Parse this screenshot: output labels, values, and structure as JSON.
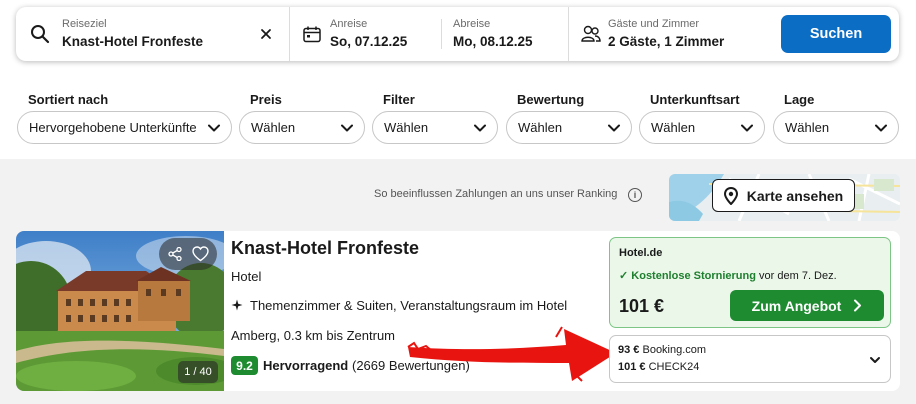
{
  "search": {
    "destination_caption": "Reiseziel",
    "destination_value": "Knast-Hotel Fronfeste",
    "checkin_caption": "Anreise",
    "checkin_value": "So, 07.12.25",
    "checkout_caption": "Abreise",
    "checkout_value": "Mo, 08.12.25",
    "guests_caption": "Gäste und Zimmer",
    "guests_value": "2 Gäste, 1 Zimmer",
    "search_button": "Suchen",
    "accent_color": "#0b6dc4"
  },
  "filters": [
    {
      "label": "Sortiert nach",
      "value": "Hervorgehobene Unterkünfte"
    },
    {
      "label": "Preis",
      "value": "Wählen"
    },
    {
      "label": "Filter",
      "value": "Wählen"
    },
    {
      "label": "Bewertung",
      "value": "Wählen"
    },
    {
      "label": "Unterkunftsart",
      "value": "Wählen"
    },
    {
      "label": "Lage",
      "value": "Wählen"
    }
  ],
  "results": {
    "ranking_note": "So beeinflussen Zahlungen an uns unser Ranking",
    "info_symbol": "i",
    "map_button": "Karte ansehen"
  },
  "hotel": {
    "name": "Knast-Hotel Fronfeste",
    "type": "Hotel",
    "features": "Themenzimmer & Suiten, Veranstaltungsraum im Hotel",
    "location": "Amberg, 0.3 km bis Zentrum",
    "rating_score": "9.2",
    "rating_label": "Hervorragend",
    "rating_count": "(2669 Bewertungen)",
    "photo_counter": "1 / 40",
    "rating_color": "#1e8b31"
  },
  "deal": {
    "provider": "Hotel.de",
    "cancellation_strong": "Kostenlose Stornierung",
    "cancellation_rest": "vor dem 7. Dez.",
    "price": "101 €",
    "button": "Zum Angebot"
  },
  "other_offers": [
    {
      "price": "93 €",
      "provider": "Booking.com"
    },
    {
      "price": "101 €",
      "provider": "CHECK24"
    }
  ]
}
